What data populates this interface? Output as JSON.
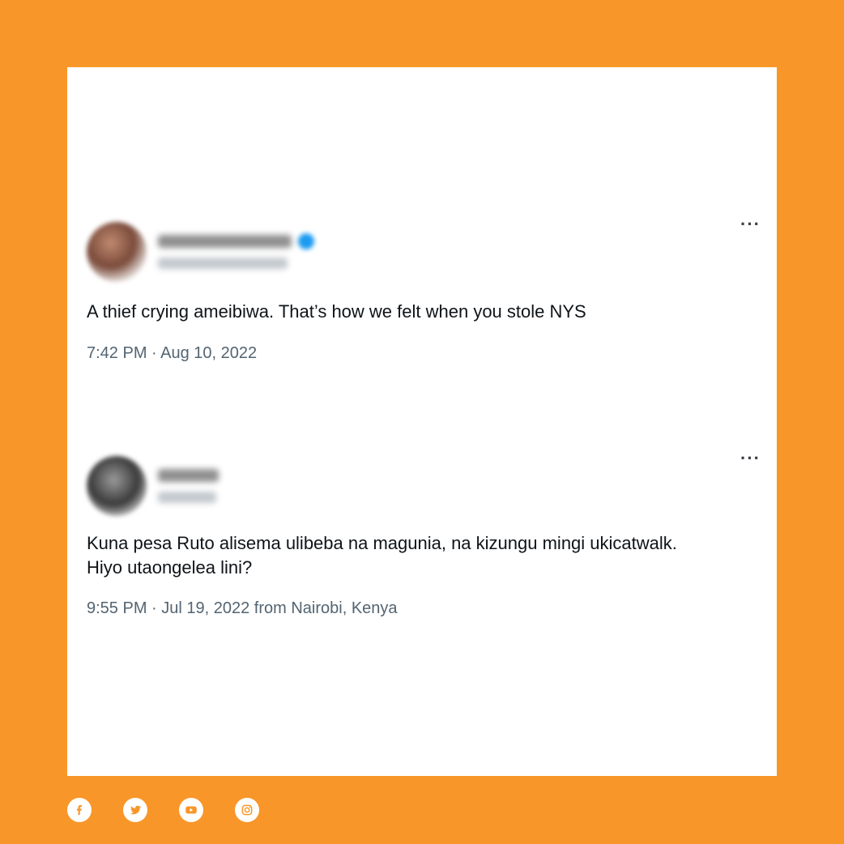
{
  "tweets": [
    {
      "text": "A thief crying ameibiwa. That’s how we felt when you stole NYS",
      "meta": "7:42 PM · Aug 10, 2022",
      "more": "···"
    },
    {
      "text": "Kuna pesa Ruto alisema ulibeba na magunia, na kizungu mingi ukicatwalk. Hiyo utaongelea  lini?",
      "meta": "9:55 PM · Jul 19, 2022 from Nairobi, Kenya",
      "more": "···"
    }
  ],
  "colors": {
    "background": "#F8962A",
    "card": "#FFFFFF",
    "text": "#0F1419",
    "meta": "#536471",
    "verified": "#1D9BF0"
  },
  "social_icons": [
    "facebook-icon",
    "twitter-icon",
    "youtube-icon",
    "instagram-icon"
  ]
}
